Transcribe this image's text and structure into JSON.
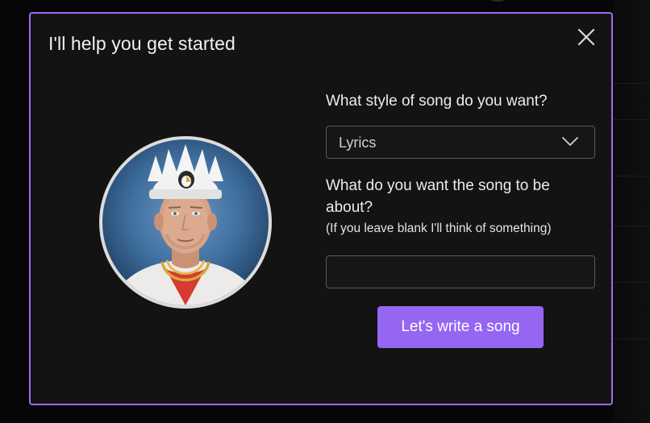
{
  "modal": {
    "title": "I'll help you get started",
    "close_icon": "close-icon",
    "avatar_alt": "avatar"
  },
  "form": {
    "style_question": "What style of song do you want?",
    "style_select": {
      "selected": "Lyrics",
      "icon": "chevron-down-icon"
    },
    "topic_question": "What do you want the song to be about?",
    "topic_hint": "(If you leave blank I'll think of something)",
    "topic_input": {
      "value": "",
      "placeholder": ""
    },
    "submit_label": "Let's write a song"
  },
  "colors": {
    "accent": "#9466f2",
    "modal_border": "#9d6bf0",
    "modal_background": "#131313"
  }
}
